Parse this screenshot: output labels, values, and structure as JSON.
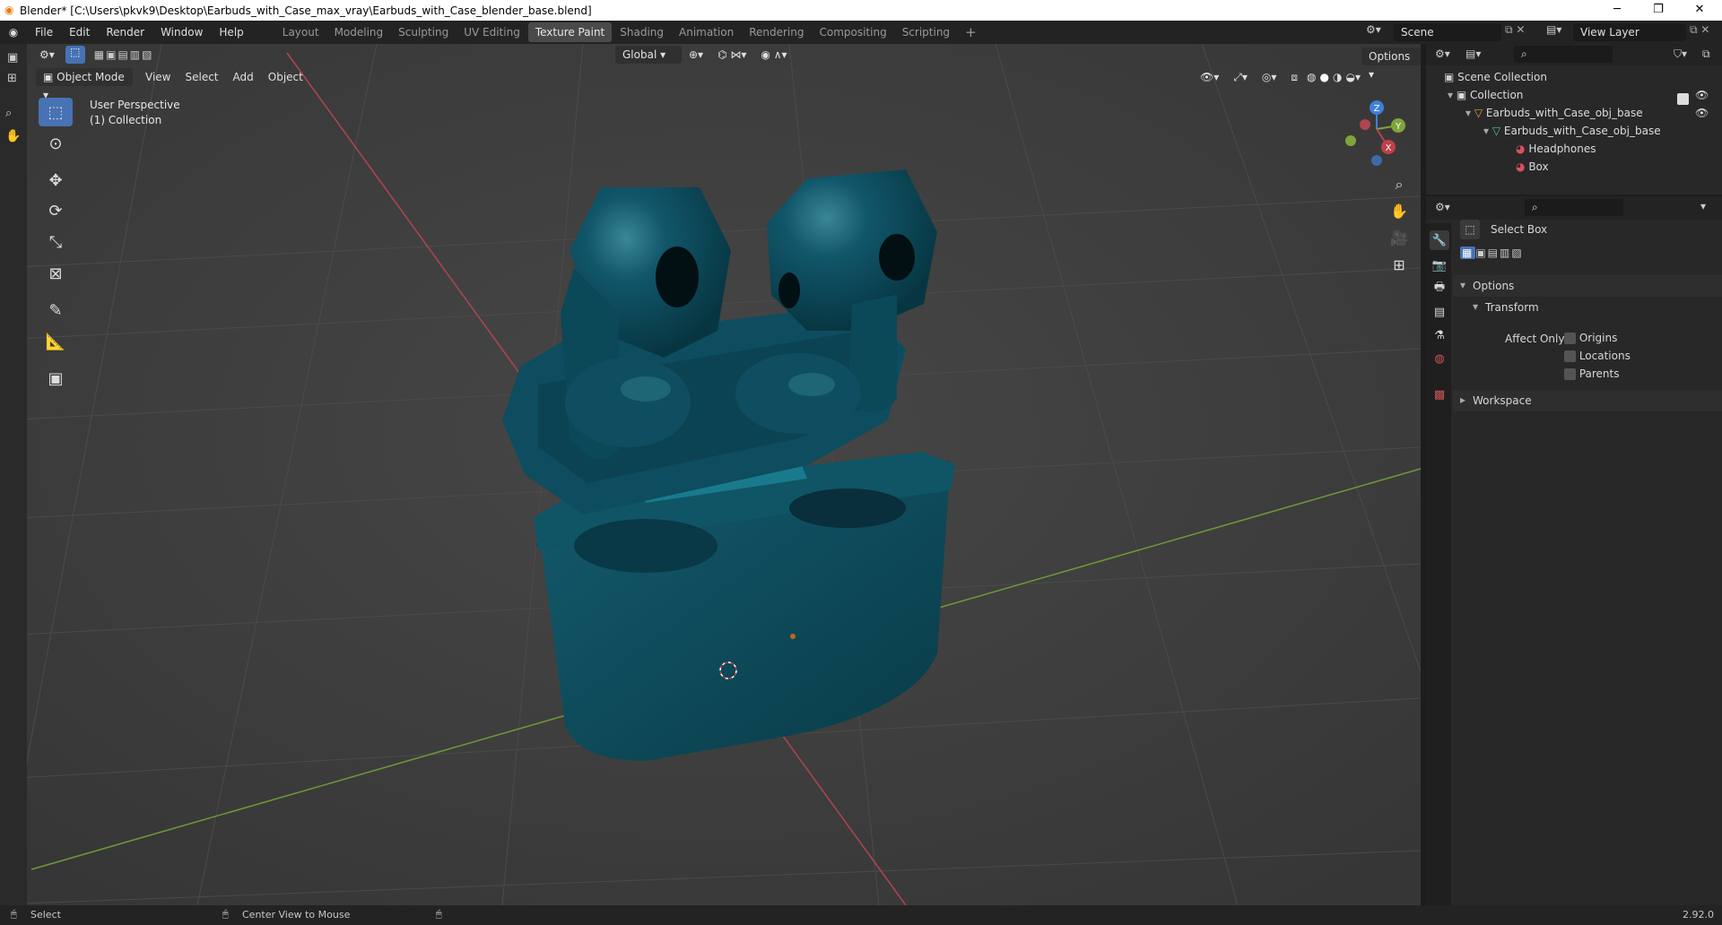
{
  "window": {
    "title": "Blender* [C:\\Users\\pkvk9\\Desktop\\Earbuds_with_Case_max_vray\\Earbuds_with_Case_blender_base.blend]"
  },
  "menu": [
    "File",
    "Edit",
    "Render",
    "Window",
    "Help"
  ],
  "workspaces": [
    "Layout",
    "Modeling",
    "Sculpting",
    "UV Editing",
    "Texture Paint",
    "Shading",
    "Animation",
    "Rendering",
    "Compositing",
    "Scripting"
  ],
  "active_workspace": "Texture Paint",
  "scene": {
    "name": "Scene",
    "view_layer": "View Layer"
  },
  "tool_header": {
    "transform_orientation": "Global",
    "options_label": "Options"
  },
  "viewport": {
    "mode": "Object Mode",
    "menus": [
      "View",
      "Select",
      "Add",
      "Object"
    ],
    "overlay_title": "User Perspective",
    "overlay_collection": "(1) Collection",
    "gizmo_axes": [
      "Z",
      "Y",
      "X"
    ]
  },
  "outliner": {
    "root": "Scene Collection",
    "items": [
      {
        "label": "Collection",
        "icon": "collection-icon"
      },
      {
        "label": "Earbuds_with_Case_obj_base",
        "icon": "object-icon"
      },
      {
        "label": "Earbuds_with_Case_obj_base",
        "icon": "mesh-icon"
      },
      {
        "label": "Headphones",
        "icon": "material-icon"
      },
      {
        "label": "Box",
        "icon": "material-icon"
      }
    ]
  },
  "properties": {
    "tool_name": "Select Box",
    "options_label": "Options",
    "transform_label": "Transform",
    "affect_only_label": "Affect Only",
    "checkboxes": [
      "Origins",
      "Locations",
      "Parents"
    ],
    "workspace_label": "Workspace"
  },
  "status": {
    "left": "Select",
    "middle": "Center View to Mouse",
    "version": "2.92.0"
  },
  "colors": {
    "accent": "#4772b3",
    "model": "#0e4a5a",
    "x_axis": "#c0404a",
    "y_axis": "#7fa53a",
    "z_axis": "#3f7fd8"
  }
}
